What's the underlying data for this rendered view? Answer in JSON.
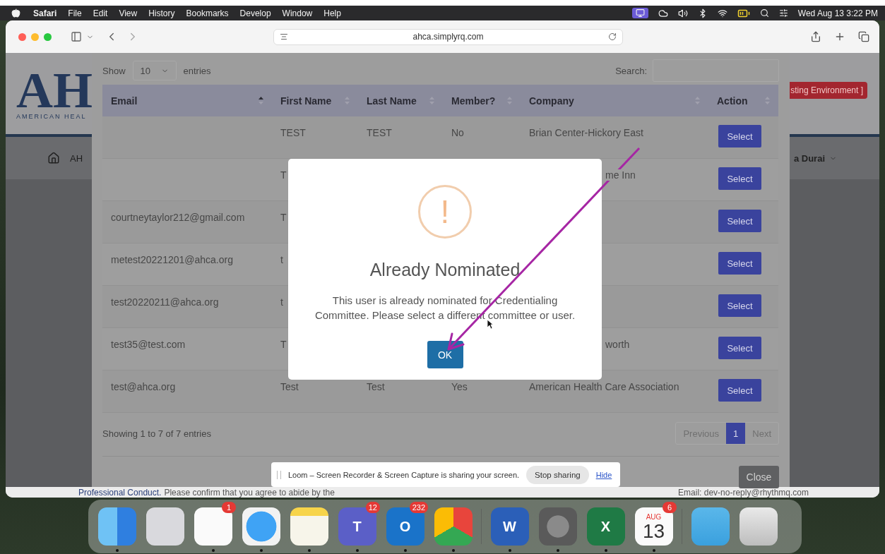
{
  "menubar": {
    "app": "Safari",
    "menus": [
      "File",
      "Edit",
      "View",
      "History",
      "Bookmarks",
      "Develop",
      "Window",
      "Help"
    ],
    "clock": "Wed Aug 13  3:22 PM"
  },
  "browser": {
    "url": "ahca.simplyrq.com"
  },
  "page": {
    "logo_letters": "AH",
    "logo_subtitle": "AMERICAN HEAL",
    "environment_badge": "sting Environment ]",
    "nav_item": "AH",
    "user_name": "a Durai",
    "footer_link": "Professional Conduct.",
    "footer_text": "Please confirm that you agree to abide by the",
    "footer_email_label": "Email:",
    "footer_email": "dev-no-reply@rhythmq.com"
  },
  "modal": {
    "show_label": "Show",
    "page_size": "10",
    "entries_label": "entries",
    "search_label": "Search:",
    "columns": [
      {
        "label": "Email",
        "sorted": true
      },
      {
        "label": "First Name",
        "sorted": false
      },
      {
        "label": "Last Name",
        "sorted": false
      },
      {
        "label": "Member?",
        "sorted": false
      },
      {
        "label": "Company",
        "sorted": false
      },
      {
        "label": "Action",
        "sorted": false
      }
    ],
    "rows": [
      {
        "first_name": "TEST",
        "last_name": "TEST",
        "member": "No",
        "company": "Brian Center-Hickory East",
        "company_clipped": false,
        "action": "Select"
      },
      {
        "first_name": "T",
        "company": "me Inn",
        "company_clipped": true,
        "action": "Select"
      },
      {
        "email": "courtneytaylor212@gmail.com",
        "first_name": "T",
        "action": "Select"
      },
      {
        "email": "metest20221201@ahca.org",
        "first_name": "t",
        "action": "Select"
      },
      {
        "email": "test20220211@ahca.org",
        "first_name": "t",
        "action": "Select"
      },
      {
        "email": "test35@test.com",
        "first_name": "T",
        "company": "worth",
        "company_clipped": true,
        "action": "Select"
      },
      {
        "email": "test@ahca.org",
        "first_name": "Test",
        "last_name": "Test",
        "member": "Yes",
        "company": "American Health Care Association",
        "company_clipped": false,
        "action": "Select"
      }
    ],
    "info": "Showing 1 to 7 of 7 entries",
    "pagination": [
      {
        "label": "Previous",
        "selected": false
      },
      {
        "label": "1",
        "selected": true
      },
      {
        "label": "Next",
        "selected": false
      }
    ],
    "close": "Close"
  },
  "alert": {
    "icon": "!",
    "title": "Already Nominated",
    "message": "This user is already nominated for Credentialing Committee. Please select a different committee or user.",
    "button": "OK"
  },
  "loom": {
    "message": "Loom – Screen Recorder & Screen Capture is sharing your screen.",
    "stop": "Stop sharing",
    "hide": "Hide"
  },
  "dock": [
    {
      "kind": "finder",
      "running": true
    },
    {
      "kind": "launchpad",
      "running": false
    },
    {
      "kind": "reminders",
      "badge": "1",
      "running": true
    },
    {
      "kind": "safari",
      "running": true
    },
    {
      "kind": "notes",
      "running": true
    },
    {
      "kind": "teams",
      "glyph": "T",
      "badge": "12",
      "running": true
    },
    {
      "kind": "outlook",
      "glyph": "O",
      "badge": "232",
      "running": true
    },
    {
      "kind": "chrome",
      "running": true
    },
    {
      "kind": "separator"
    },
    {
      "kind": "word",
      "glyph": "W",
      "running": true
    },
    {
      "kind": "settings",
      "running": true
    },
    {
      "kind": "excel",
      "glyph": "X",
      "running": true
    },
    {
      "kind": "calendar",
      "month": "AUG",
      "day": "13",
      "badge": "6",
      "running": true
    },
    {
      "kind": "separator"
    },
    {
      "kind": "folder",
      "running": false
    },
    {
      "kind": "trash",
      "running": false
    }
  ]
}
